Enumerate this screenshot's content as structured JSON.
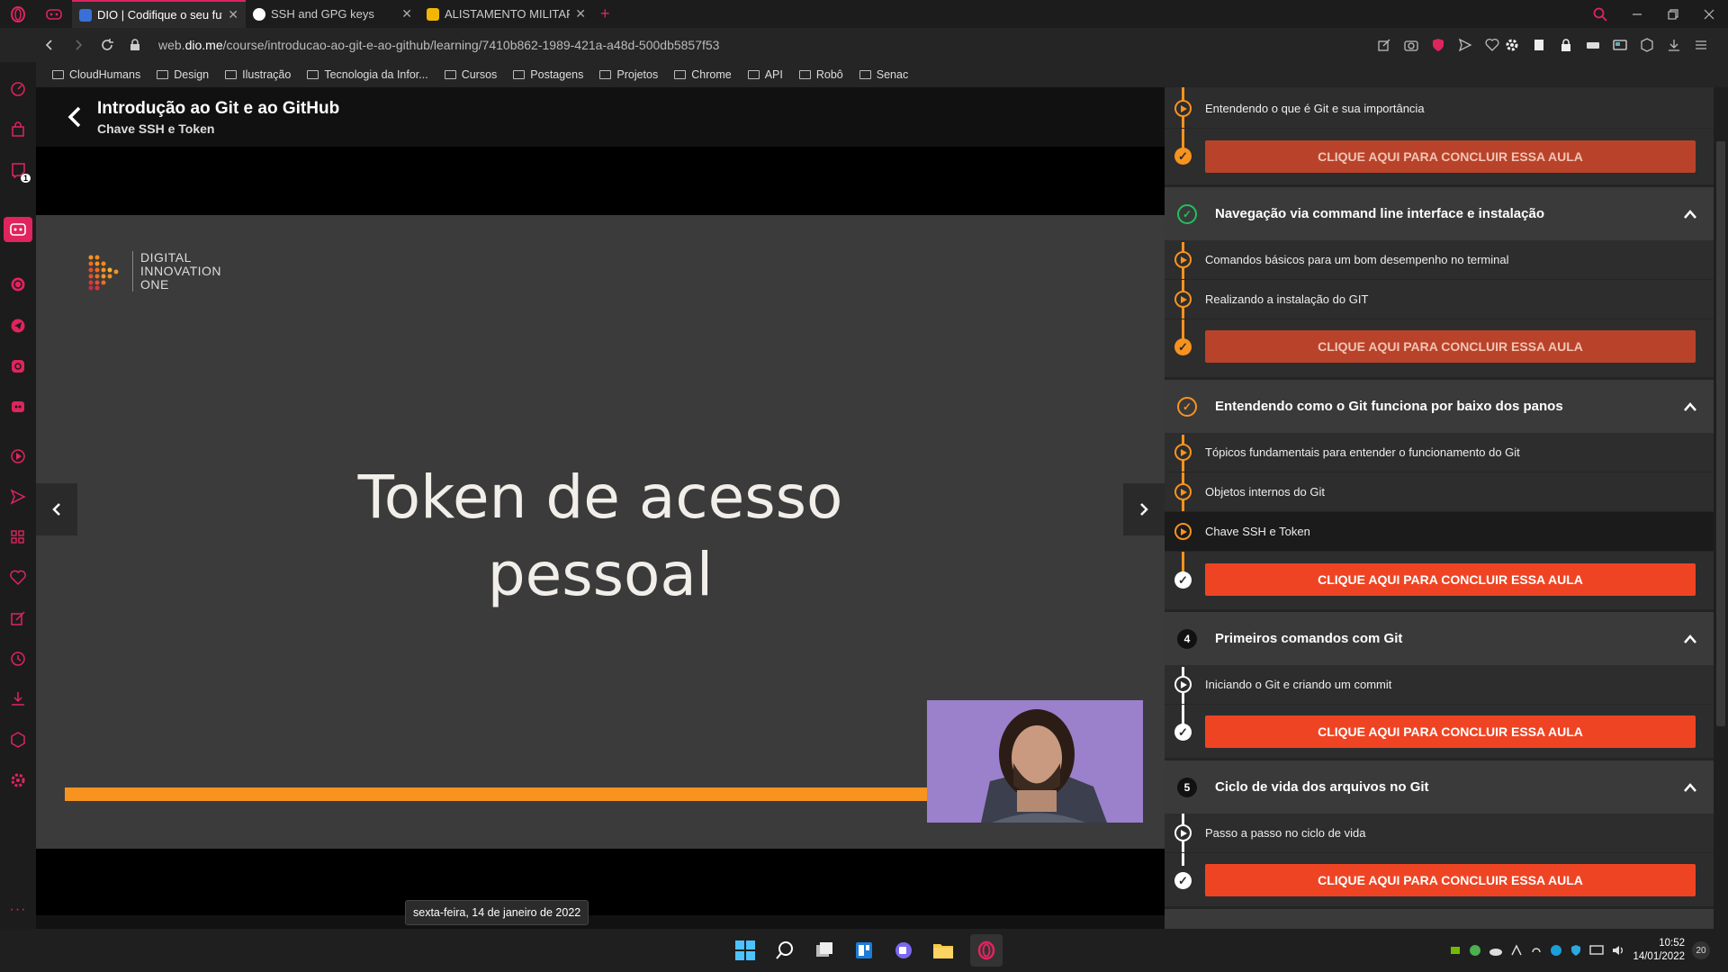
{
  "browser": {
    "tabs": [
      {
        "title": "DIO | Codifique o seu futur",
        "active": true
      },
      {
        "title": "SSH and GPG keys",
        "active": false
      },
      {
        "title": "ALISTAMENTO MILITAR ON",
        "active": false
      }
    ],
    "url_prefix": "web.",
    "url_domain": "dio.me",
    "url_path": "/course/introducao-ao-git-e-ao-github/learning/7410b862-1989-421a-a48d-500db5857f53",
    "bookmarks": [
      "CloudHumans",
      "Design",
      "Ilustração",
      "Tecnologia da Infor...",
      "Cursos",
      "Postagens",
      "Projetos",
      "Chrome",
      "API",
      "Robô",
      "Senac"
    ],
    "accent": "#e0245e",
    "sidebar_badge": "1"
  },
  "course": {
    "title": "Introdução ao Git e ao GitHub",
    "lesson": "Chave SSH e Token"
  },
  "slide": {
    "logo_lines": [
      "DIGITAL",
      "INNOVATION",
      "ONE"
    ],
    "text_line1": "Token de acesso",
    "text_line2": "pessoal",
    "accent": "#f7931e"
  },
  "date_tooltip": "sexta-feira, 14 de janeiro de 2022",
  "panel": {
    "top_lesson": "Entendendo o que é Git e sua importância",
    "complete_label": "CLIQUE AQUI PARA CONCLUIR ESSA AULA",
    "sections": [
      {
        "title": "Navegação via command line interface e instalação",
        "lessons": [
          "Comandos básicos para um bom desempenho no terminal",
          "Realizando a instalação do GIT"
        ]
      },
      {
        "title": "Entendendo como o Git funciona por baixo dos panos",
        "lessons": [
          "Tópicos fundamentais para entender o funcionamento do Git",
          "Objetos internos do Git",
          "Chave SSH e Token"
        ]
      },
      {
        "number": "4",
        "title": "Primeiros comandos com Git",
        "lessons": [
          "Iniciando o Git e criando um commit"
        ]
      },
      {
        "number": "5",
        "title": "Ciclo de vida dos arquivos no Git",
        "lessons": [
          "Passo a passo no ciclo de vida"
        ]
      }
    ]
  },
  "taskbar": {
    "time": "10:52",
    "date": "14/01/2022",
    "notif": "20"
  }
}
